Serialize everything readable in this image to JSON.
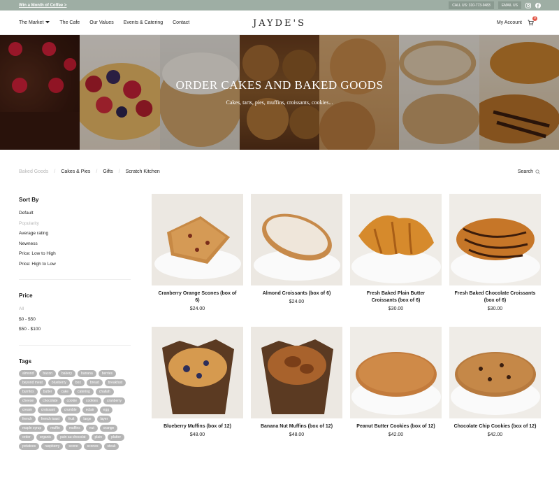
{
  "topbar": {
    "promo": "Win a Month of Coffee >",
    "call": "CALL US: 310-773-9483",
    "email": "EMAIL US"
  },
  "nav": {
    "items": [
      "The Market",
      "The Cafe",
      "Our Values",
      "Events & Catering",
      "Contact"
    ],
    "logo": "JAYDE'S",
    "account": "My Account",
    "cart_count": "0"
  },
  "hero": {
    "title": "ORDER CAKES AND BAKED GOODS",
    "subtitle": "Cakes, tarts, pies, muffins, croissants, cookies..."
  },
  "categories": {
    "items": [
      "Baked Goods",
      "Cakes & Pies",
      "Gifts",
      "Scratch Kitchen"
    ],
    "search": "Search"
  },
  "sidebar": {
    "sort_title": "Sort By",
    "sort_options": [
      "Default",
      "Popularity",
      "Average rating",
      "Newness",
      "Price: Low to High",
      "Price: High to Low"
    ],
    "price_title": "Price",
    "price_options": [
      "All",
      "$0 - $50",
      "$50 - $100"
    ],
    "tags_title": "Tags",
    "tags": [
      "almond",
      "bacon",
      "bakery",
      "banana",
      "berries",
      "beyond meat",
      "blueberry",
      "box",
      "bread",
      "breakfast",
      "burritos",
      "butter",
      "cake",
      "catering",
      "challah",
      "cheese",
      "chocolate",
      "cookie",
      "cookies",
      "cranberry",
      "cream",
      "croissant",
      "crumble",
      "eclair",
      "egg",
      "french",
      "french toast",
      "fruit",
      "large",
      "layer",
      "maple syrup",
      "muffin",
      "muffins",
      "nut",
      "orange",
      "order",
      "organic",
      "pain au chocolat",
      "plain",
      "platter",
      "potatoes",
      "raspberry",
      "scone",
      "scones",
      "steak"
    ]
  },
  "products": [
    {
      "name": "Cranberry Orange Scones (box of 6)",
      "price": "$24.00"
    },
    {
      "name": "Almond Croissants (box of 6)",
      "price": "$24.00"
    },
    {
      "name": "Fresh Baked Plain Butter Croissants (box of 6)",
      "price": "$30.00"
    },
    {
      "name": "Fresh Baked Chocolate Croissants (box of 6)",
      "price": "$30.00"
    },
    {
      "name": "Blueberry Muffins (box of 12)",
      "price": "$48.00"
    },
    {
      "name": "Banana Nut Muffins (box of 12)",
      "price": "$48.00"
    },
    {
      "name": "Peanut Butter Cookies (box of 12)",
      "price": "$42.00"
    },
    {
      "name": "Chocolate Chip Cookies (box of 12)",
      "price": "$42.00"
    }
  ]
}
